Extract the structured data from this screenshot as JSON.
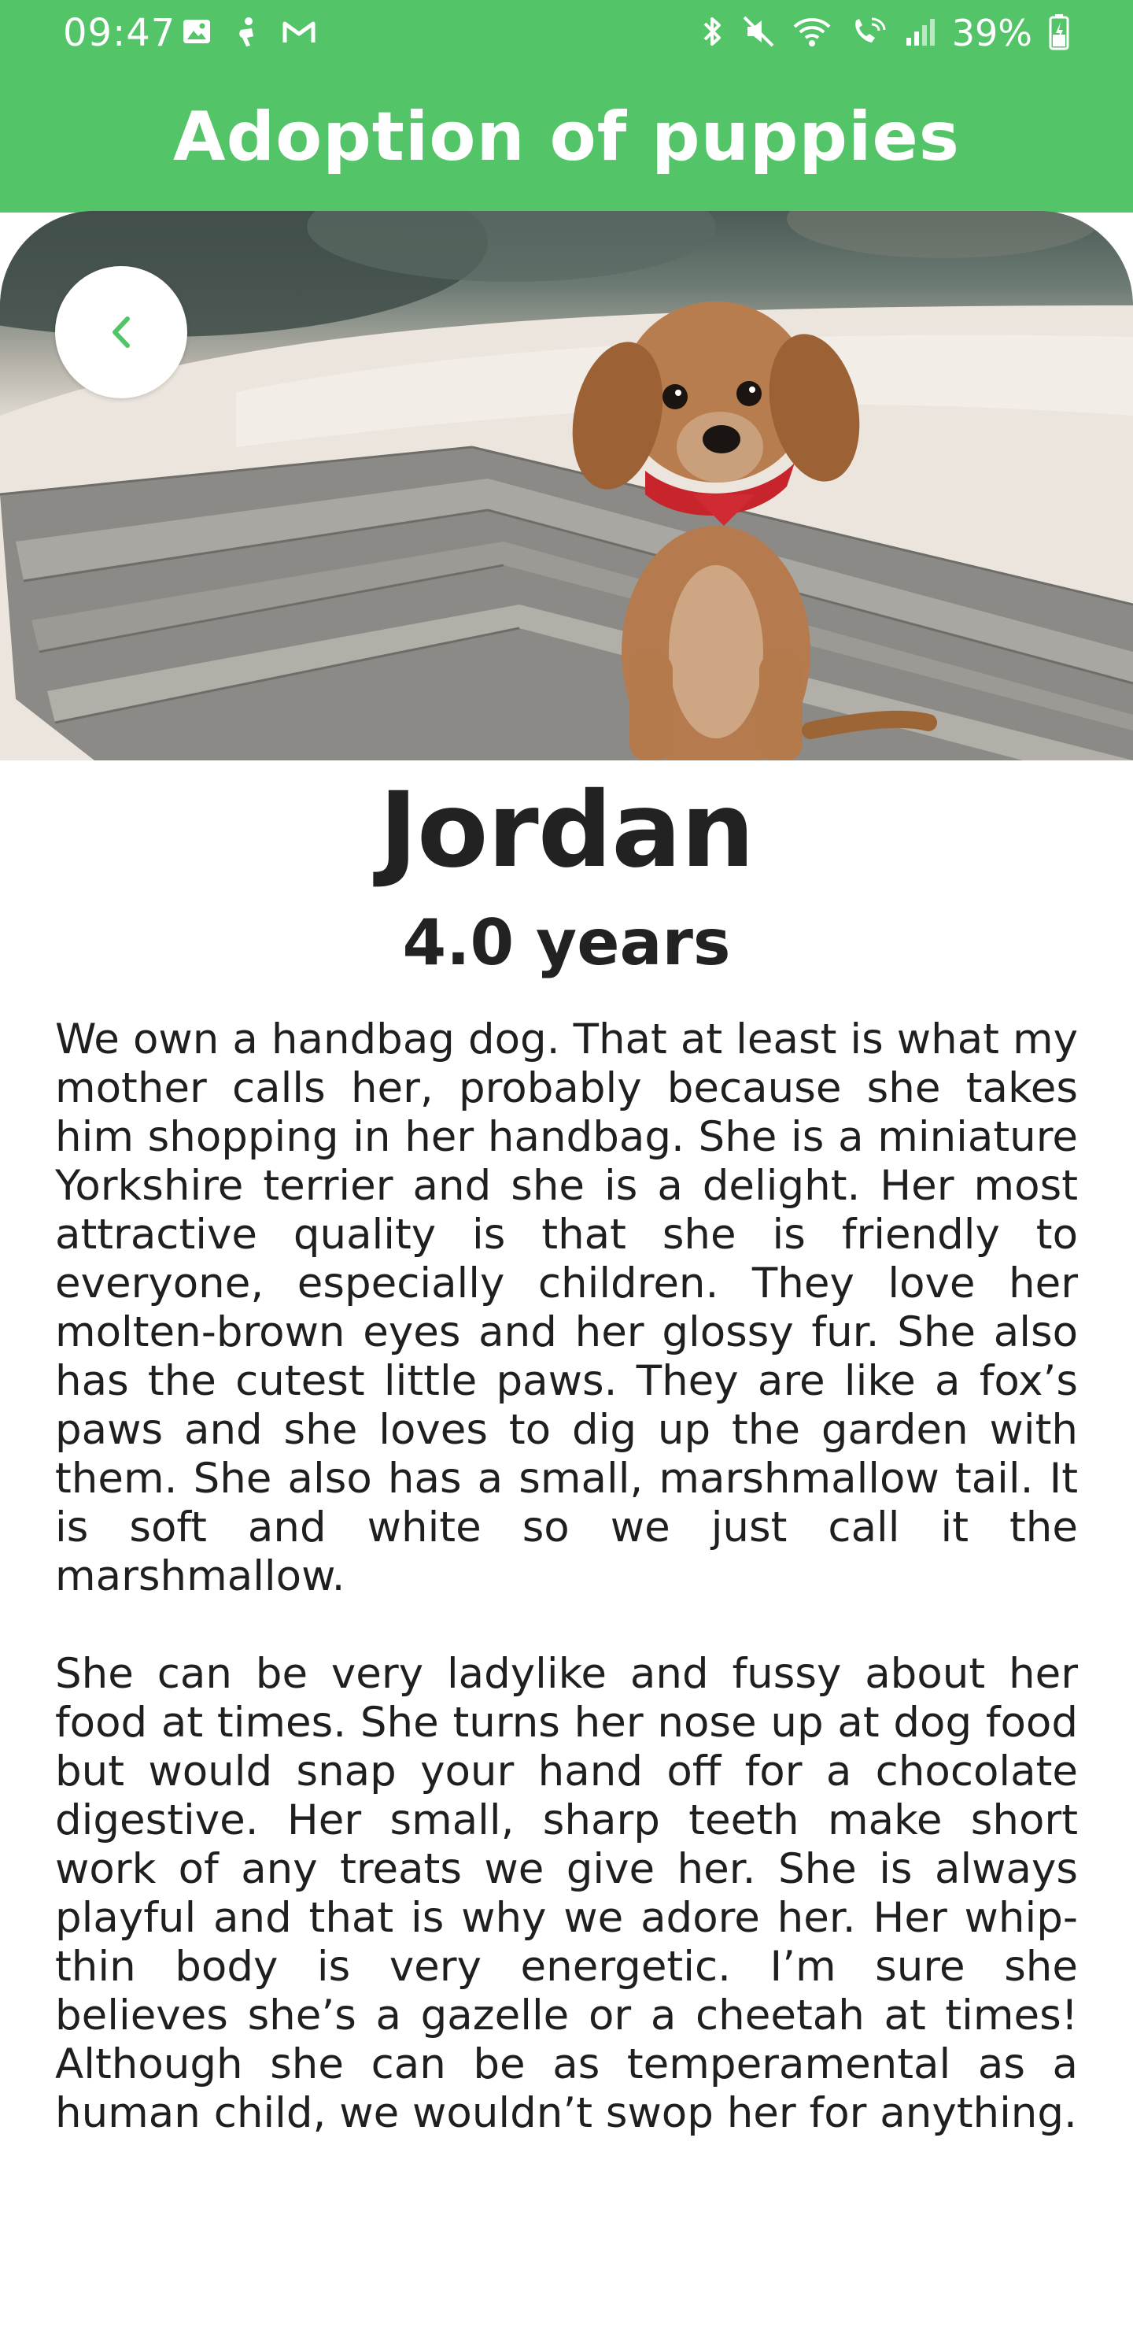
{
  "status_bar": {
    "time": "09:47",
    "battery": "39%",
    "left_icons": [
      "image-icon",
      "accessibility-icon",
      "gmail-icon"
    ],
    "right_icons": [
      "bluetooth-icon",
      "mute-icon",
      "wifi-icon",
      "wifi-calling-icon",
      "signal-icon",
      "battery-icon"
    ]
  },
  "header": {
    "title": "Adoption of puppies"
  },
  "hero": {
    "image_subject": "puppy-photo",
    "back_icon": "chevron-left-icon"
  },
  "pet": {
    "name": "Jordan",
    "age": "4.0 years",
    "description": [
      "We own a handbag dog. That at least is what my mother calls her, probably because she takes him shopping in her handbag. She is a miniature Yorkshire terrier and she is a delight. Her most attractive quality is that she is friendly to everyone, especially children. They love her molten-brown eyes and her glossy fur. She also has the cutest little paws. They are like a fox’s paws and she loves to dig up the garden with them. She also has a small, marshmallow tail. It is soft and white so we just call it the marshmallow.",
      " She can be very ladylike and fussy about her food at times. She turns her nose up at dog food but would snap your hand off for a chocolate digestive. Her small, sharp teeth make short work of any treats we give her. She is always playful and that is why we adore her. Her whip-thin body is very energetic. I’m sure she believes she’s a gazelle or a cheetah at times! Although she can be as temperamental as a human child, we wouldn’t swop her for anything."
    ]
  },
  "colors": {
    "primary_green": "#54C468",
    "text_dark": "#222222",
    "background": "#ffffff"
  }
}
